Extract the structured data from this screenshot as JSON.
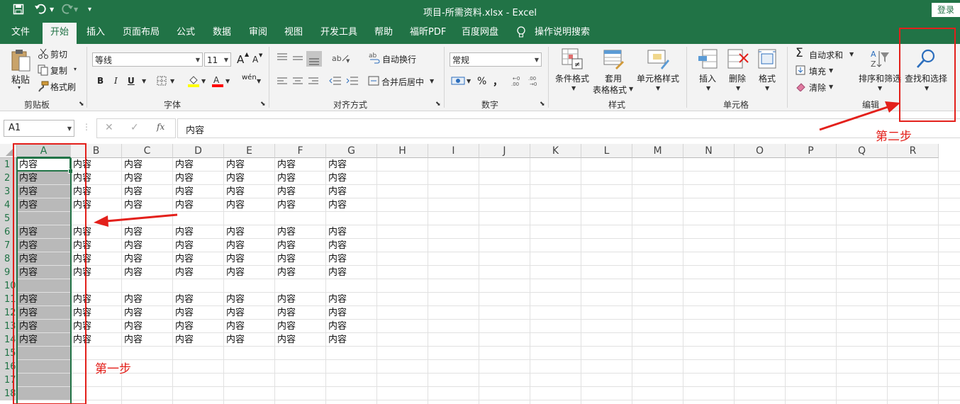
{
  "title_bar": {
    "title": "项目-所需资料.xlsx  -  Excel",
    "login": "登录",
    "save_icon": "save-icon",
    "undo_icon": "undo-icon",
    "redo_icon": "redo-icon",
    "customize_icon": "customize-icon"
  },
  "tabs": [
    "文件",
    "开始",
    "插入",
    "页面布局",
    "公式",
    "数据",
    "审阅",
    "视图",
    "开发工具",
    "帮助",
    "福昕PDF",
    "百度网盘",
    "操作说明搜索"
  ],
  "active_tab": "开始",
  "ribbon": {
    "clipboard": {
      "paste": "粘贴",
      "cut": "剪切",
      "copy": "复制",
      "format_painter": "格式刷",
      "group": "剪贴板"
    },
    "font": {
      "font_name": "等线",
      "font_size": "11",
      "bold": "B",
      "italic": "I",
      "underline": "U",
      "group": "字体",
      "grow": "A",
      "shrink": "A",
      "phonetic": "wén"
    },
    "alignment": {
      "wrap": "自动换行",
      "merge": "合并后居中",
      "group": "对齐方式"
    },
    "number": {
      "format": "常规",
      "percent": "%",
      "comma": "，",
      "group": "数字"
    },
    "styles": {
      "conditional": "条件格式",
      "table_line1": "套用",
      "table_line2": "表格格式",
      "cell_styles": "单元格样式",
      "group": "样式"
    },
    "cells": {
      "insert": "插入",
      "delete": "删除",
      "format": "格式",
      "group": "单元格"
    },
    "editing": {
      "autosum": "自动求和",
      "fill": "填充",
      "clear": "清除",
      "sort_filter": "排序和筛选",
      "find_select": "查找和选择",
      "group": "编辑"
    }
  },
  "formula_bar": {
    "name_box": "A1",
    "fx": "fx",
    "value": "内容"
  },
  "columns": [
    "A",
    "B",
    "C",
    "D",
    "E",
    "F",
    "G",
    "H",
    "I",
    "J",
    "K",
    "L",
    "M",
    "N",
    "O",
    "P",
    "Q",
    "R"
  ],
  "rows": [
    "1",
    "2",
    "3",
    "4",
    "5",
    "6",
    "7",
    "8",
    "9",
    "10",
    "11",
    "12",
    "13",
    "14",
    "15",
    "16",
    "17",
    "18"
  ],
  "cells": [
    [
      "内容",
      "内容",
      "内容",
      "内容",
      "内容",
      "内容",
      "内容"
    ],
    [
      "内容",
      "内容",
      "内容",
      "内容",
      "内容",
      "内容",
      "内容"
    ],
    [
      "内容",
      "内容",
      "内容",
      "内容",
      "内容",
      "内容",
      "内容"
    ],
    [
      "内容",
      "内容",
      "内容",
      "内容",
      "内容",
      "内容",
      "内容"
    ],
    [
      "",
      "",
      "",
      "",
      "",
      "",
      ""
    ],
    [
      "内容",
      "内容",
      "内容",
      "内容",
      "内容",
      "内容",
      "内容"
    ],
    [
      "内容",
      "内容",
      "内容",
      "内容",
      "内容",
      "内容",
      "内容"
    ],
    [
      "内容",
      "内容",
      "内容",
      "内容",
      "内容",
      "内容",
      "内容"
    ],
    [
      "内容",
      "内容",
      "内容",
      "内容",
      "内容",
      "内容",
      "内容"
    ],
    [
      "",
      "",
      "",
      "",
      "",
      "",
      ""
    ],
    [
      "内容",
      "内容",
      "内容",
      "内容",
      "内容",
      "内容",
      "内容"
    ],
    [
      "内容",
      "内容",
      "内容",
      "内容",
      "内容",
      "内容",
      "内容"
    ],
    [
      "内容",
      "内容",
      "内容",
      "内容",
      "内容",
      "内容",
      "内容"
    ],
    [
      "内容",
      "内容",
      "内容",
      "内容",
      "内容",
      "内容",
      "内容"
    ],
    [
      "",
      "",
      "",
      "",
      "",
      "",
      ""
    ],
    [
      "",
      "",
      "",
      "",
      "",
      "",
      ""
    ],
    [
      "",
      "",
      "",
      "",
      "",
      "",
      ""
    ],
    [
      "",
      "",
      "",
      "",
      "",
      "",
      ""
    ]
  ],
  "annotations": {
    "step1": "第一步",
    "step2": "第二步",
    "color": "#e3201b"
  },
  "colors": {
    "excel_green": "#217346",
    "selection_gray": "#b9b9b9"
  }
}
